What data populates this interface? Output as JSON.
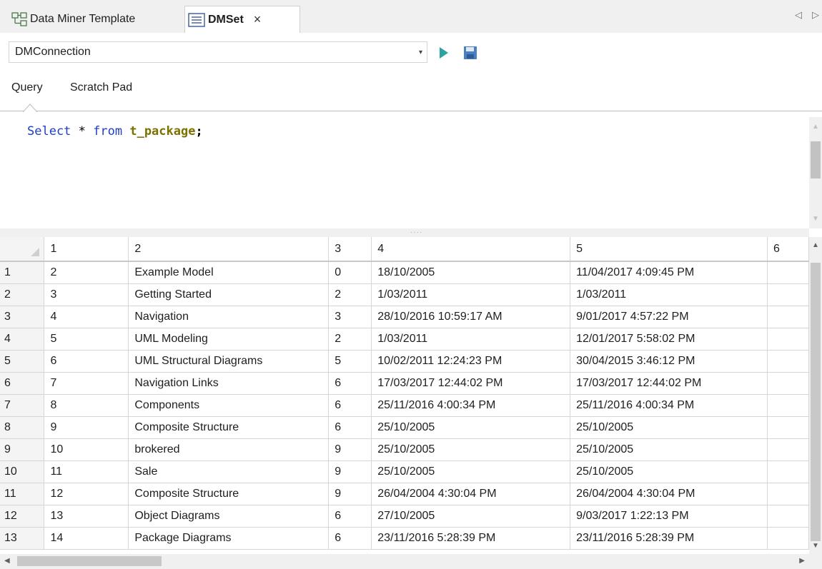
{
  "tabs": [
    {
      "label": "Data Miner Template",
      "icon": "diagram-icon",
      "active": false
    },
    {
      "label": "DMSet",
      "icon": "list-doc-icon",
      "active": true,
      "close": "×"
    }
  ],
  "tab_scroll": {
    "left": "◁",
    "right": "▷"
  },
  "connection": {
    "value": "DMConnection",
    "dropdown": "▾"
  },
  "query_tabs": [
    "Query",
    "Scratch Pad"
  ],
  "editor": {
    "kw_select": "Select",
    "star": " * ",
    "kw_from": "from",
    "table": "t_package",
    "semi": ";"
  },
  "grid": {
    "columns": [
      "1",
      "2",
      "3",
      "4",
      "5",
      "6"
    ],
    "rows": [
      {
        "n": "1",
        "c": [
          "2",
          "Example Model",
          "0",
          "18/10/2005",
          "11/04/2017 4:09:45 PM",
          ""
        ]
      },
      {
        "n": "2",
        "c": [
          "3",
          "Getting Started",
          "2",
          "1/03/2011",
          "1/03/2011",
          ""
        ]
      },
      {
        "n": "3",
        "c": [
          "4",
          "Navigation",
          "3",
          "28/10/2016 10:59:17 AM",
          "9/01/2017 4:57:22 PM",
          ""
        ]
      },
      {
        "n": "4",
        "c": [
          "5",
          "UML Modeling",
          "2",
          "1/03/2011",
          "12/01/2017 5:58:02 PM",
          ""
        ]
      },
      {
        "n": "5",
        "c": [
          "6",
          "UML Structural Diagrams",
          "5",
          "10/02/2011 12:24:23 PM",
          "30/04/2015 3:46:12 PM",
          ""
        ]
      },
      {
        "n": "6",
        "c": [
          "7",
          "Navigation Links",
          "6",
          "17/03/2017 12:44:02 PM",
          "17/03/2017 12:44:02 PM",
          ""
        ]
      },
      {
        "n": "7",
        "c": [
          "8",
          "Components",
          "6",
          "25/11/2016 4:00:34 PM",
          "25/11/2016 4:00:34 PM",
          ""
        ]
      },
      {
        "n": "8",
        "c": [
          "9",
          "Composite Structure",
          "6",
          "25/10/2005",
          "25/10/2005",
          ""
        ]
      },
      {
        "n": "9",
        "c": [
          "10",
          "brokered",
          "9",
          "25/10/2005",
          "25/10/2005",
          ""
        ]
      },
      {
        "n": "10",
        "c": [
          "11",
          "Sale",
          "9",
          "25/10/2005",
          "25/10/2005",
          ""
        ]
      },
      {
        "n": "11",
        "c": [
          "12",
          "Composite Structure",
          "9",
          "26/04/2004 4:30:04 PM",
          "26/04/2004 4:30:04 PM",
          ""
        ]
      },
      {
        "n": "12",
        "c": [
          "13",
          "Object Diagrams",
          "6",
          "27/10/2005",
          "9/03/2017 1:22:13 PM",
          ""
        ]
      },
      {
        "n": "13",
        "c": [
          "14",
          "Package Diagrams",
          "6",
          "23/11/2016 5:28:39 PM",
          "23/11/2016 5:28:39 PM",
          ""
        ]
      }
    ]
  },
  "colors": {
    "keyword": "#1f3cc8",
    "table_name": "#7a7200",
    "run": "#2aa3a3",
    "save": "#4a7fc1"
  }
}
